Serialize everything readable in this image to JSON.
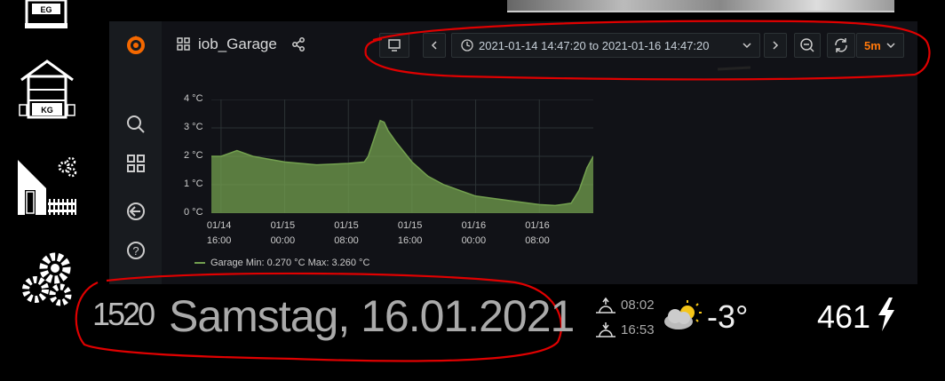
{
  "left_nav": {
    "items": [
      {
        "icon": "house-eg-icon",
        "label": "EG"
      },
      {
        "icon": "house-kg-icon",
        "label": "KG"
      },
      {
        "icon": "garden-house-icon"
      },
      {
        "icon": "settings-gears-icon"
      }
    ]
  },
  "grafana": {
    "dashboard_title": "iob_Garage",
    "time_range": "2021-01-14 14:47:20 to 2021-01-16 14:47:20",
    "refresh_interval": "5m"
  },
  "chart_data": {
    "type": "area",
    "series": [
      {
        "name": "Garage",
        "color": "#73a04f",
        "x": [
          "01/14 14:47",
          "01/14 16:00",
          "01/14 18:00",
          "01/14 20:00",
          "01/14 22:00",
          "01/15 00:00",
          "01/15 04:00",
          "01/15 08:00",
          "01/15 10:00",
          "01/15 10:30",
          "01/15 12:00",
          "01/15 12:30",
          "01/15 13:00",
          "01/15 14:00",
          "01/15 16:00",
          "01/15 18:00",
          "01/15 20:00",
          "01/15 22:00",
          "01/16 00:00",
          "01/16 04:00",
          "01/16 08:00",
          "01/16 10:00",
          "01/16 12:00",
          "01/16 13:00",
          "01/16 14:00",
          "01/16 14:47"
        ],
        "y": [
          2.0,
          2.0,
          2.2,
          2.0,
          1.9,
          1.8,
          1.7,
          1.75,
          1.8,
          2.0,
          3.26,
          3.2,
          2.9,
          2.5,
          1.8,
          1.3,
          1.0,
          0.8,
          0.6,
          0.45,
          0.3,
          0.27,
          0.35,
          0.8,
          1.6,
          2.0
        ]
      }
    ],
    "x_ticks": [
      "01/14\n16:00",
      "01/15\n00:00",
      "01/15\n08:00",
      "01/15\n16:00",
      "01/16\n00:00",
      "01/16\n08:00"
    ],
    "y_ticks": [
      "0 °C",
      "1 °C",
      "2 °C",
      "3 °C",
      "4 °C"
    ],
    "ylim": [
      0,
      4
    ],
    "grid": true,
    "legend": {
      "position": "bottom-left",
      "text": "Garage  Min: 0.270 °C  Max: 3.260 °C"
    }
  },
  "info_bar": {
    "clock": "1520",
    "date": "Samstag, 16.01.2021",
    "sunrise": "08:02",
    "sunset": "16:53",
    "temperature": "-3°",
    "power": "461"
  },
  "colors": {
    "grafana_orange": "#f46800",
    "annotation_red": "#e00000",
    "series_green": "#73a04f"
  }
}
